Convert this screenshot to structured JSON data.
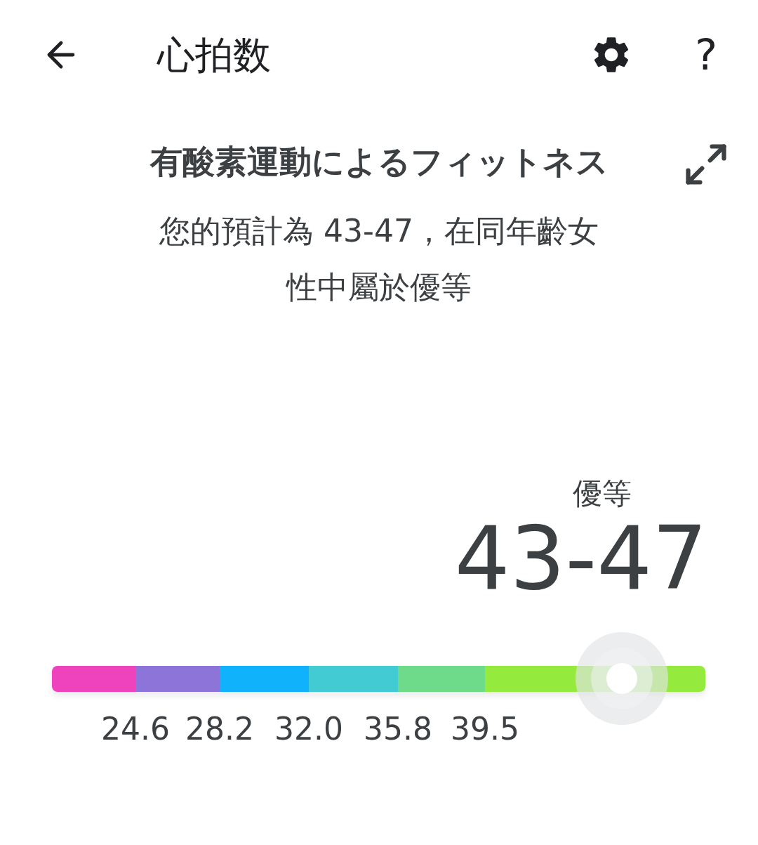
{
  "header": {
    "title": "心拍数",
    "help": "?"
  },
  "card": {
    "title": "有酸素運動によるフィットネス",
    "summary": "您的預計為 43-47，在同年齡女性中屬於優等"
  },
  "result": {
    "rating": "優等",
    "value": "43-47"
  },
  "scale": {
    "level": 0.872,
    "zones": [
      {
        "color": "#ef42bd"
      },
      {
        "color": "#8c74d8"
      },
      {
        "color": "#10b2fc"
      },
      {
        "color": "#43cbd4"
      },
      {
        "color": "#6ddb8a"
      },
      {
        "color": "#95eb3d"
      }
    ],
    "ticks": [
      "24.6",
      "28.2",
      "32.0",
      "35.8",
      "39.5"
    ]
  }
}
